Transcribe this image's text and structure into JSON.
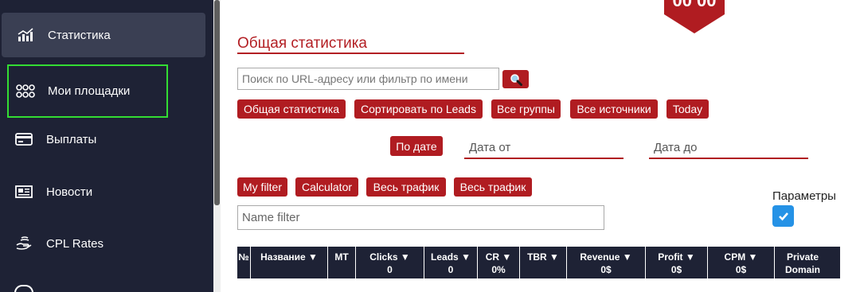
{
  "sidebar": {
    "items": [
      {
        "label": "Статистика",
        "icon": "chart-growth-icon"
      },
      {
        "label": "Мои площадки",
        "icon": "sites-grid-icon"
      },
      {
        "label": "Выплаты",
        "icon": "credit-card-icon"
      },
      {
        "label": "Новости",
        "icon": "newspaper-icon"
      },
      {
        "label": "CPL Rates",
        "icon": "hand-coins-icon"
      }
    ]
  },
  "header": {
    "ribbon_text": "00 00"
  },
  "main": {
    "title": "Общая статистика",
    "search": {
      "placeholder": "Поиск по URL-адресу или фильтр по имени",
      "value": ""
    },
    "filter_buttons": [
      "Общая статистика",
      "Сортировать по Leads",
      "Все группы",
      "Все источники",
      "Today"
    ],
    "by_date_label": "По дате",
    "date_from_placeholder": "Дата от",
    "date_to_placeholder": "Дата до",
    "tool_buttons": [
      "My filter",
      "Calculator",
      "Весь трафик",
      "Весь трафик"
    ],
    "name_filter_placeholder": "Name filter",
    "params_label": "Параметры",
    "params_checked": true
  },
  "table": {
    "columns": [
      {
        "label": "№",
        "sub": ""
      },
      {
        "label": "Название ▼",
        "sub": ""
      },
      {
        "label": "MT",
        "sub": ""
      },
      {
        "label": "Clicks ▼",
        "sub": "0"
      },
      {
        "label": "Leads ▼",
        "sub": "0"
      },
      {
        "label": "CR ▼",
        "sub": "0%"
      },
      {
        "label": "TBR ▼",
        "sub": ""
      },
      {
        "label": "Revenue ▼",
        "sub": "0$"
      },
      {
        "label": "Profit ▼",
        "sub": "0$"
      },
      {
        "label": "CPM ▼",
        "sub": "0$"
      },
      {
        "label": "Private",
        "sub": "Domain"
      }
    ]
  },
  "colors": {
    "accent": "#b01c21",
    "sidebar_bg": "#1e2235",
    "active_item": "#3a3f53",
    "focus_border": "#33dd33",
    "checkbox": "#2592e6"
  }
}
